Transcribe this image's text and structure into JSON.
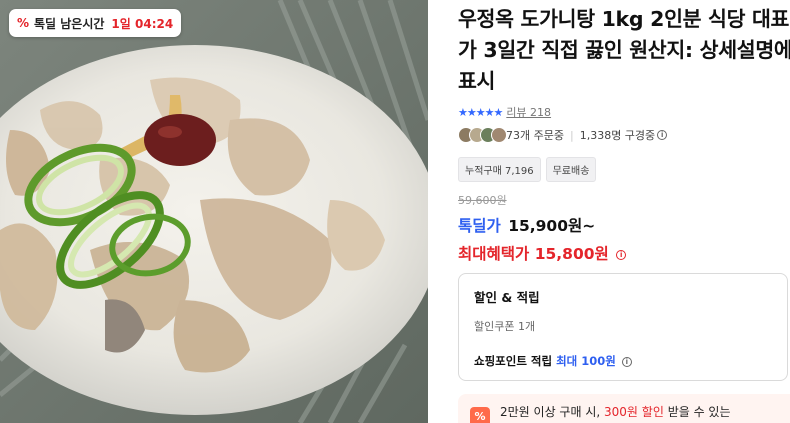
{
  "deal_badge": {
    "icon": "percent-icon",
    "label": "톡딜 남은시간",
    "time": "1일 04:24",
    "accent": "#e4252b"
  },
  "product": {
    "title": "우정옥 도가니탕 1kg 2인분 식당 대표가 3일간 직접 끓인 원산지: 상세설명에 표시",
    "rating_icon": "star-icon",
    "stars": "★★★★★",
    "review_label": "리뷰 218",
    "buyers_text": "73개 주문중",
    "subscribers_text": "1,338명 구경중",
    "tags": [
      "누적구매 7,196",
      "무료배송"
    ]
  },
  "price": {
    "original": "59,600원",
    "deal_label": "톡딜가",
    "deal_price": "15,900원~",
    "max_benefit": "최대혜택가 15,800원",
    "deal_color": "#2e5ff0",
    "max_color": "#e4252b"
  },
  "benefit": {
    "title": "할인 & 적립",
    "coupon": "할인쿠폰 1개",
    "point_label": "쇼핑포인트 적립",
    "point_value": "최대 100원"
  },
  "promo": {
    "icon": "discount-tag-icon",
    "text_before": "2만원 이상 구매 시,",
    "highlight": "300원 할인",
    "text_after": "받을 수 있는"
  }
}
